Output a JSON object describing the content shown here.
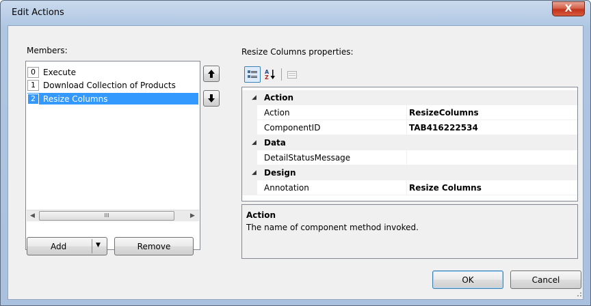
{
  "window": {
    "title": "Edit Actions",
    "close_label": "X"
  },
  "members": {
    "label": "Members:",
    "items": [
      {
        "index": "0",
        "label": "Execute",
        "selected": false
      },
      {
        "index": "1",
        "label": "Download Collection of Products",
        "selected": false
      },
      {
        "index": "2",
        "label": "Resize Columns",
        "selected": true
      }
    ],
    "scrollbar": {
      "thumb_glyph": "III",
      "left_arrow": "◀",
      "right_arrow": "▶"
    },
    "add_label": "Add",
    "remove_label": "Remove"
  },
  "properties": {
    "label": "Resize Columns properties:",
    "toolbar": [
      "categorized-icon",
      "alphabetical-icon",
      "property-pages-icon"
    ],
    "groups": [
      {
        "name": "Action",
        "rows": [
          {
            "name": "Action",
            "value": "ResizeColumns"
          },
          {
            "name": "ComponentID",
            "value": "TAB416222534"
          }
        ]
      },
      {
        "name": "Data",
        "rows": [
          {
            "name": "DetailStatusMessage",
            "value": ""
          }
        ]
      },
      {
        "name": "Design",
        "rows": [
          {
            "name": "Annotation",
            "value": "Resize Columns"
          }
        ]
      }
    ],
    "description": {
      "title": "Action",
      "text": "The name of component method invoked."
    }
  },
  "footer": {
    "ok_label": "OK",
    "cancel_label": "Cancel"
  },
  "colors": {
    "selection": "#3399ff",
    "title_gradient_top": "#c9d9ec",
    "close_red": "#c2341a"
  }
}
